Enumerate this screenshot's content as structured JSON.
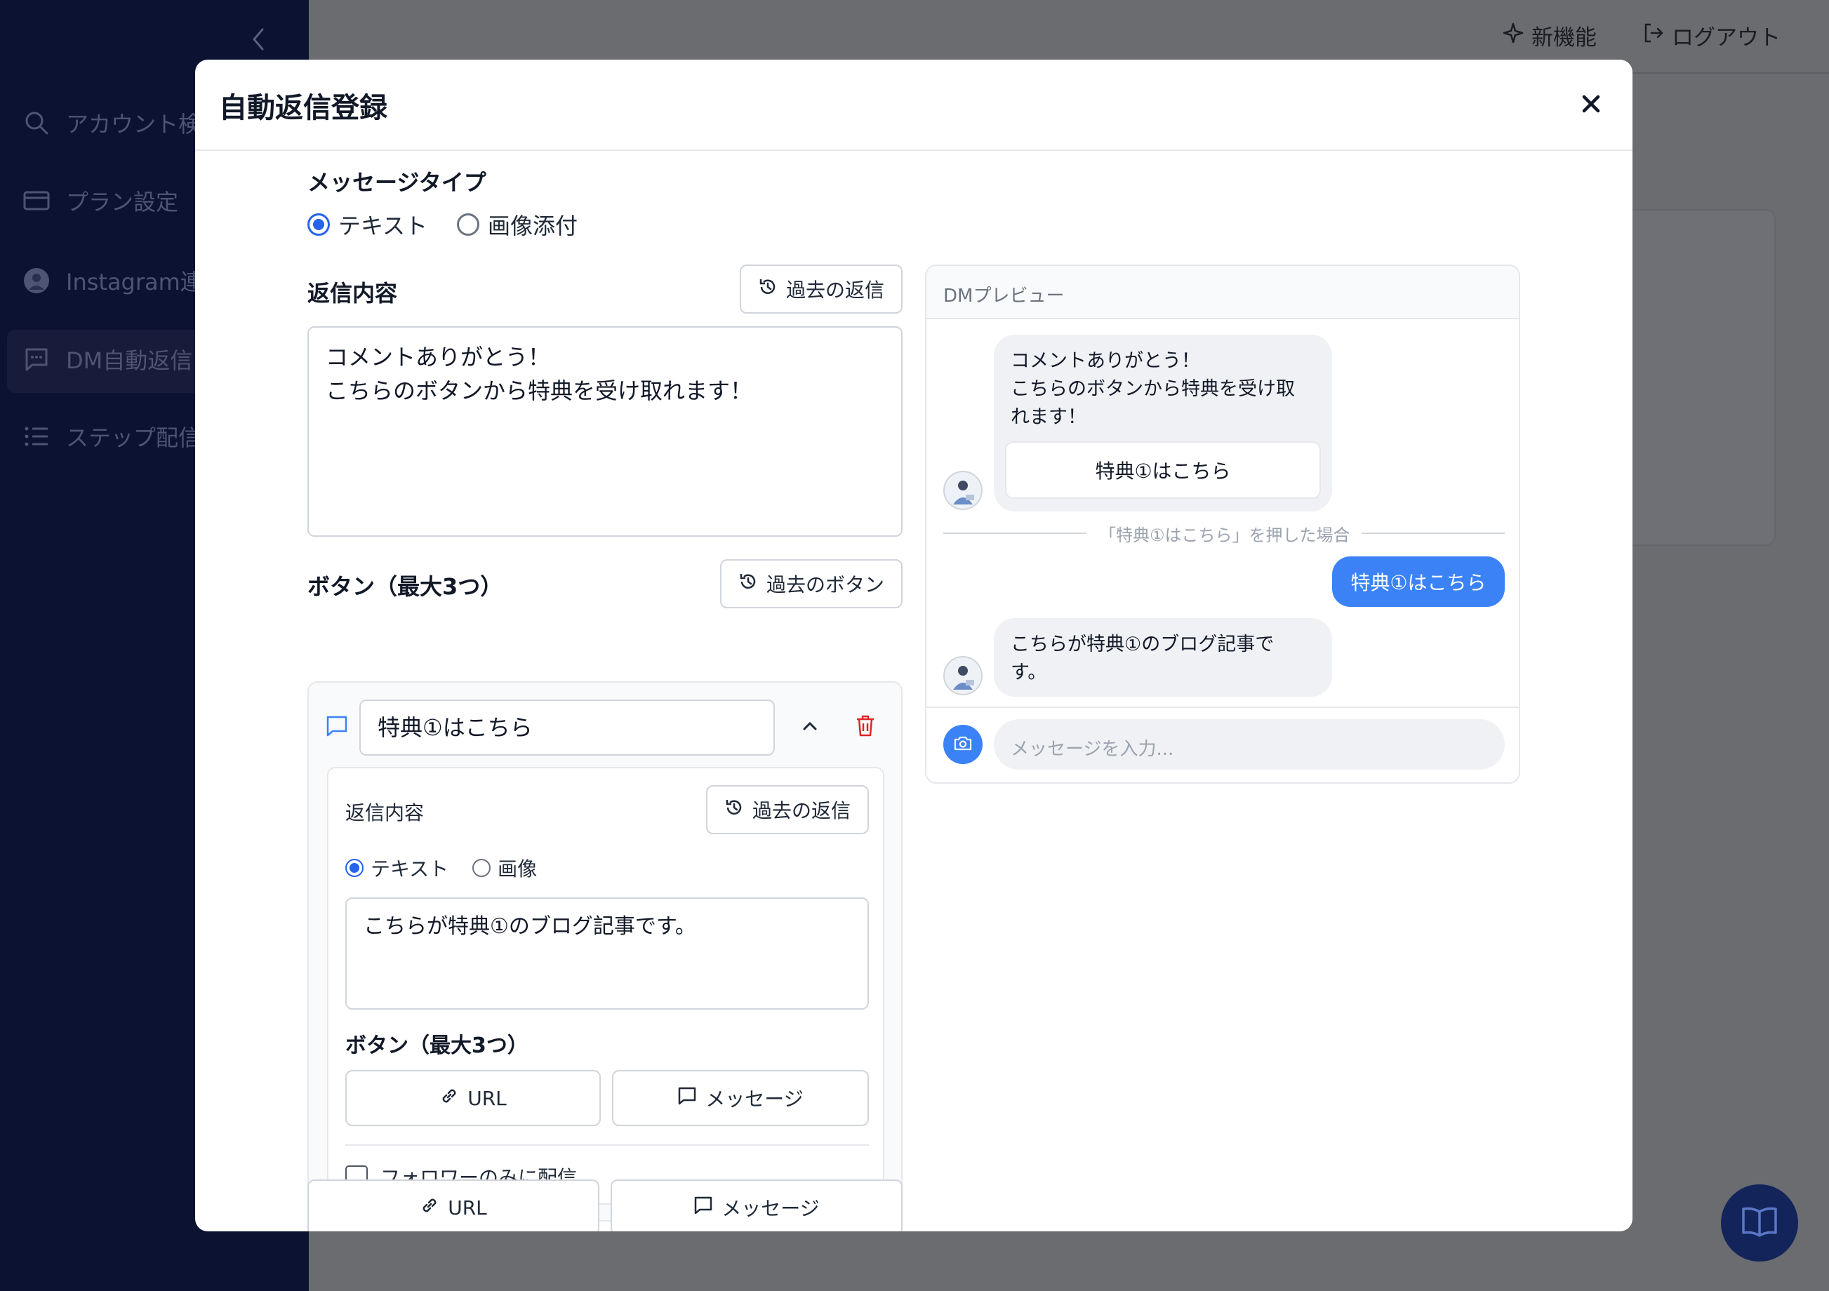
{
  "background": {
    "topbar": {
      "new_features": "新機能",
      "logout": "ログアウト"
    },
    "sidebar": {
      "items": [
        {
          "label": "アカウント検",
          "icon": "search-icon"
        },
        {
          "label": "プラン設定",
          "icon": "credit-card-icon"
        },
        {
          "label": "Instagram連",
          "icon": "instagram-avatar-icon"
        },
        {
          "label": "DM自動返信",
          "icon": "message-square-icon"
        },
        {
          "label": "ステップ配信",
          "icon": "list-icon"
        }
      ]
    }
  },
  "modal": {
    "title": "自動返信登録",
    "message_type": {
      "label": "メッセージタイプ",
      "options": [
        "テキスト",
        "画像添付"
      ],
      "selected": "テキスト"
    },
    "reply": {
      "label": "返信内容",
      "history_button": "過去の返信",
      "value": "コメントありがとう！\nこちらのボタンから特典を受け取れます！"
    },
    "buttons": {
      "label": "ボタン（最大3つ）",
      "history_button": "過去のボタン",
      "item": {
        "title_value": "特典①はこちら",
        "reply_label": "返信内容",
        "history_button": "過去の返信",
        "type_options": [
          "テキスト",
          "画像"
        ],
        "type_selected": "テキスト",
        "reply_value": "こちらが特典①のブログ記事です。",
        "sub_buttons_label": "ボタン（最大3つ）",
        "add_url": "URL",
        "add_message": "メッセージ",
        "followers_only": "フォロワーのみに配信"
      },
      "add_url": "URL",
      "add_message": "メッセージ"
    },
    "preview": {
      "title": "DMプレビュー",
      "message_1": "コメントありがとう！\nこちらのボタンから特典を受け取\nれます！",
      "message_1_button": "特典①はこちら",
      "divider": "「特典①はこちら」を押した場合",
      "user_reply": "特典①はこちら",
      "message_2": "こちらが特典①のブログ記事で\nす。",
      "input_placeholder": "メッセージを入力..."
    }
  },
  "colors": {
    "accent": "#3b82f6",
    "radio": "#2563eb",
    "danger": "#dc2626",
    "sidebar_bg": "#0c1231"
  }
}
